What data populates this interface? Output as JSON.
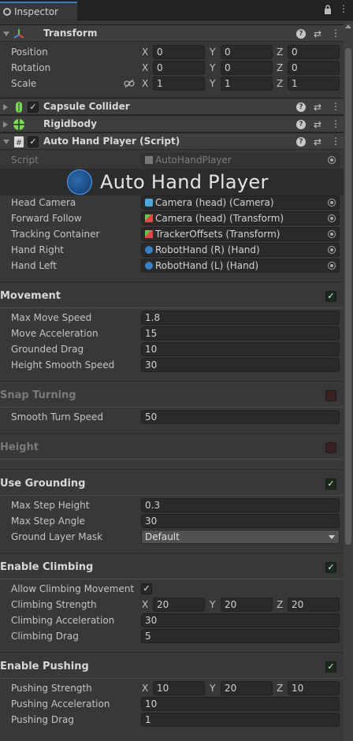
{
  "window": {
    "tab_label": "Inspector",
    "menu_icon": "kebab-menu-icon",
    "lock_icon": "lock-icon"
  },
  "transform": {
    "title": "Transform",
    "position_label": "Position",
    "rotation_label": "Rotation",
    "scale_label": "Scale",
    "axis_x": "X",
    "axis_y": "Y",
    "axis_z": "Z",
    "position": [
      "0",
      "0",
      "0"
    ],
    "rotation": [
      "0",
      "0",
      "0"
    ],
    "scale": [
      "1",
      "1",
      "1"
    ]
  },
  "components": {
    "capsule_collider": "Capsule Collider",
    "rigidbody": "Rigidbody",
    "auto_hand_player": "Auto Hand Player (Script)"
  },
  "script_row": {
    "label": "Script",
    "value": "AutoHandPlayer"
  },
  "banner": {
    "title": "Auto Hand Player"
  },
  "references": [
    {
      "label": "Head Camera",
      "value": "Camera (head) (Camera)"
    },
    {
      "label": "Forward Follow",
      "value": "Camera (head) (Transform)"
    },
    {
      "label": "Tracking Container",
      "value": "TrackerOffsets (Transform)"
    },
    {
      "label": "Hand Right",
      "value": "RobotHand (R) (Hand)"
    },
    {
      "label": "Hand Left",
      "value": "RobotHand (L) (Hand)"
    }
  ],
  "movement": {
    "title": "Movement",
    "fields": [
      {
        "label": "Max Move Speed",
        "value": "1.8"
      },
      {
        "label": "Move Acceleration",
        "value": "15"
      },
      {
        "label": "Grounded Drag",
        "value": "10"
      },
      {
        "label": "Height Smooth Speed",
        "value": "30"
      }
    ]
  },
  "snap_turning": {
    "title": "Snap Turning",
    "fields": [
      {
        "label": "Smooth Turn Speed",
        "value": "50"
      }
    ]
  },
  "height": {
    "title": "Height"
  },
  "grounding": {
    "title": "Use Grounding",
    "max_step_height_label": "Max Step Height",
    "max_step_height": "0.3",
    "max_step_angle_label": "Max Step Angle",
    "max_step_angle": "30",
    "ground_layer_label": "Ground Layer Mask",
    "ground_layer_value": "Default"
  },
  "climbing": {
    "title": "Enable Climbing",
    "allow_label": "Allow Climbing Movement",
    "strength_label": "Climbing Strength",
    "strength": [
      "20",
      "20",
      "20"
    ],
    "acceleration_label": "Climbing Acceleration",
    "acceleration": "30",
    "drag_label": "Climbing Drag",
    "drag": "5"
  },
  "pushing": {
    "title": "Enable Pushing",
    "strength_label": "Pushing Strength",
    "strength": [
      "10",
      "20",
      "10"
    ],
    "acceleration_label": "Pushing Acceleration",
    "acceleration": "10",
    "drag_label": "Pushing Drag",
    "drag": "1"
  },
  "colors": {
    "accent": "#3a79bb",
    "check_green": "#1c2a1c",
    "check_off_red": "#3a2222"
  }
}
